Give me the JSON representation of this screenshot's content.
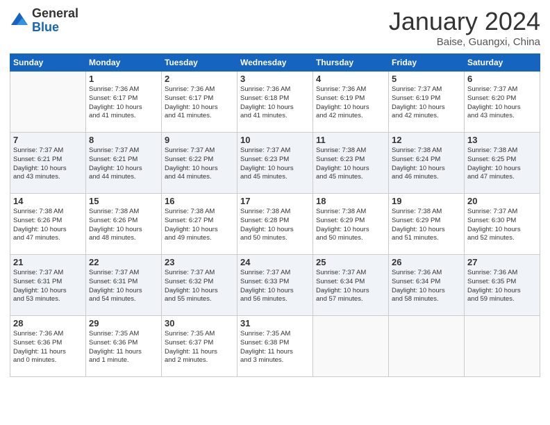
{
  "logo": {
    "general": "General",
    "blue": "Blue"
  },
  "header": {
    "month": "January 2024",
    "location": "Baise, Guangxi, China"
  },
  "weekdays": [
    "Sunday",
    "Monday",
    "Tuesday",
    "Wednesday",
    "Thursday",
    "Friday",
    "Saturday"
  ],
  "weeks": [
    [
      {
        "day": "",
        "info": ""
      },
      {
        "day": "1",
        "info": "Sunrise: 7:36 AM\nSunset: 6:17 PM\nDaylight: 10 hours\nand 41 minutes."
      },
      {
        "day": "2",
        "info": "Sunrise: 7:36 AM\nSunset: 6:17 PM\nDaylight: 10 hours\nand 41 minutes."
      },
      {
        "day": "3",
        "info": "Sunrise: 7:36 AM\nSunset: 6:18 PM\nDaylight: 10 hours\nand 41 minutes."
      },
      {
        "day": "4",
        "info": "Sunrise: 7:36 AM\nSunset: 6:19 PM\nDaylight: 10 hours\nand 42 minutes."
      },
      {
        "day": "5",
        "info": "Sunrise: 7:37 AM\nSunset: 6:19 PM\nDaylight: 10 hours\nand 42 minutes."
      },
      {
        "day": "6",
        "info": "Sunrise: 7:37 AM\nSunset: 6:20 PM\nDaylight: 10 hours\nand 43 minutes."
      }
    ],
    [
      {
        "day": "7",
        "info": "Sunrise: 7:37 AM\nSunset: 6:21 PM\nDaylight: 10 hours\nand 43 minutes."
      },
      {
        "day": "8",
        "info": "Sunrise: 7:37 AM\nSunset: 6:21 PM\nDaylight: 10 hours\nand 44 minutes."
      },
      {
        "day": "9",
        "info": "Sunrise: 7:37 AM\nSunset: 6:22 PM\nDaylight: 10 hours\nand 44 minutes."
      },
      {
        "day": "10",
        "info": "Sunrise: 7:37 AM\nSunset: 6:23 PM\nDaylight: 10 hours\nand 45 minutes."
      },
      {
        "day": "11",
        "info": "Sunrise: 7:38 AM\nSunset: 6:23 PM\nDaylight: 10 hours\nand 45 minutes."
      },
      {
        "day": "12",
        "info": "Sunrise: 7:38 AM\nSunset: 6:24 PM\nDaylight: 10 hours\nand 46 minutes."
      },
      {
        "day": "13",
        "info": "Sunrise: 7:38 AM\nSunset: 6:25 PM\nDaylight: 10 hours\nand 47 minutes."
      }
    ],
    [
      {
        "day": "14",
        "info": "Sunrise: 7:38 AM\nSunset: 6:26 PM\nDaylight: 10 hours\nand 47 minutes."
      },
      {
        "day": "15",
        "info": "Sunrise: 7:38 AM\nSunset: 6:26 PM\nDaylight: 10 hours\nand 48 minutes."
      },
      {
        "day": "16",
        "info": "Sunrise: 7:38 AM\nSunset: 6:27 PM\nDaylight: 10 hours\nand 49 minutes."
      },
      {
        "day": "17",
        "info": "Sunrise: 7:38 AM\nSunset: 6:28 PM\nDaylight: 10 hours\nand 50 minutes."
      },
      {
        "day": "18",
        "info": "Sunrise: 7:38 AM\nSunset: 6:29 PM\nDaylight: 10 hours\nand 50 minutes."
      },
      {
        "day": "19",
        "info": "Sunrise: 7:38 AM\nSunset: 6:29 PM\nDaylight: 10 hours\nand 51 minutes."
      },
      {
        "day": "20",
        "info": "Sunrise: 7:37 AM\nSunset: 6:30 PM\nDaylight: 10 hours\nand 52 minutes."
      }
    ],
    [
      {
        "day": "21",
        "info": "Sunrise: 7:37 AM\nSunset: 6:31 PM\nDaylight: 10 hours\nand 53 minutes."
      },
      {
        "day": "22",
        "info": "Sunrise: 7:37 AM\nSunset: 6:31 PM\nDaylight: 10 hours\nand 54 minutes."
      },
      {
        "day": "23",
        "info": "Sunrise: 7:37 AM\nSunset: 6:32 PM\nDaylight: 10 hours\nand 55 minutes."
      },
      {
        "day": "24",
        "info": "Sunrise: 7:37 AM\nSunset: 6:33 PM\nDaylight: 10 hours\nand 56 minutes."
      },
      {
        "day": "25",
        "info": "Sunrise: 7:37 AM\nSunset: 6:34 PM\nDaylight: 10 hours\nand 57 minutes."
      },
      {
        "day": "26",
        "info": "Sunrise: 7:36 AM\nSunset: 6:34 PM\nDaylight: 10 hours\nand 58 minutes."
      },
      {
        "day": "27",
        "info": "Sunrise: 7:36 AM\nSunset: 6:35 PM\nDaylight: 10 hours\nand 59 minutes."
      }
    ],
    [
      {
        "day": "28",
        "info": "Sunrise: 7:36 AM\nSunset: 6:36 PM\nDaylight: 11 hours\nand 0 minutes."
      },
      {
        "day": "29",
        "info": "Sunrise: 7:35 AM\nSunset: 6:36 PM\nDaylight: 11 hours\nand 1 minute."
      },
      {
        "day": "30",
        "info": "Sunrise: 7:35 AM\nSunset: 6:37 PM\nDaylight: 11 hours\nand 2 minutes."
      },
      {
        "day": "31",
        "info": "Sunrise: 7:35 AM\nSunset: 6:38 PM\nDaylight: 11 hours\nand 3 minutes."
      },
      {
        "day": "",
        "info": ""
      },
      {
        "day": "",
        "info": ""
      },
      {
        "day": "",
        "info": ""
      }
    ]
  ]
}
